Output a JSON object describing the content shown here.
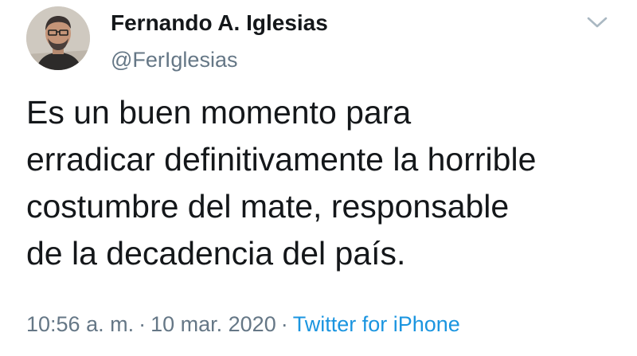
{
  "tweet": {
    "author": {
      "display_name": "Fernando A. Iglesias",
      "handle": "@FerIglesias"
    },
    "text_lines": [
      "Es un buen momento para",
      "erradicar definitivamente la horrible",
      "costumbre del mate, responsable",
      "de la decadencia del país."
    ],
    "time": "10:56 a. m.",
    "separator": "·",
    "date": "10 mar. 2020",
    "source": "Twitter for iPhone"
  },
  "icons": {
    "caret": "chevron-down-icon",
    "avatar": "avatar"
  },
  "colors": {
    "text": "#14171a",
    "secondary": "#657786",
    "link": "#1b95e0",
    "caret": "#aab8c2"
  }
}
